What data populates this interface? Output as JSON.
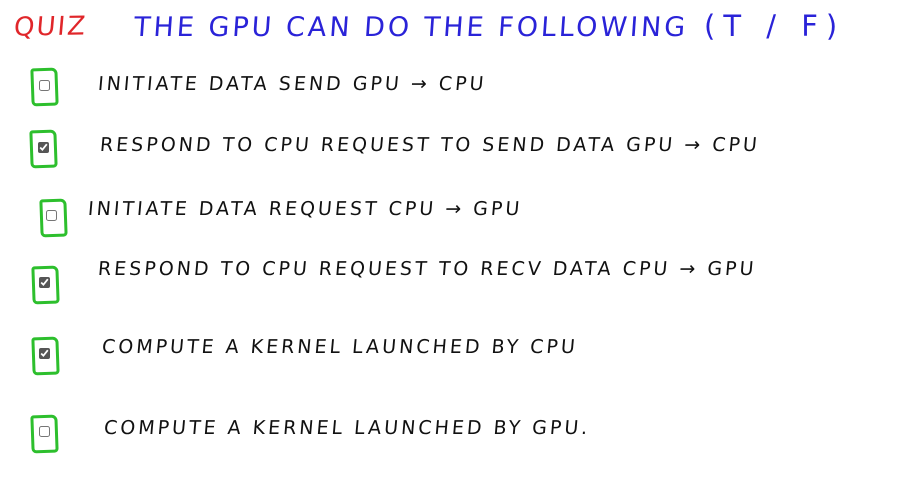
{
  "title": {
    "quiz_label": "QUIZ",
    "question": "THE GPU CAN DO THE FOLLOWING",
    "answer_format": "(T / F)"
  },
  "colors": {
    "quiz_label": "#e0262a",
    "question": "#2a23d8",
    "checkbox_frame": "#2dbf2d",
    "text": "#111111"
  },
  "items": [
    {
      "label": "INITIATE DATA SEND GPU → CPU",
      "checked": false
    },
    {
      "label": "RESPOND TO CPU REQUEST TO SEND DATA GPU → CPU",
      "checked": true
    },
    {
      "label": "INITIATE DATA REQUEST CPU → GPU",
      "checked": false
    },
    {
      "label": "RESPOND TO CPU REQUEST TO RECV DATA CPU → GPU",
      "checked": true
    },
    {
      "label": "COMPUTE A KERNEL LAUNCHED BY CPU",
      "checked": true
    },
    {
      "label": "COMPUTE A KERNEL LAUNCHED BY GPU.",
      "checked": false
    }
  ]
}
